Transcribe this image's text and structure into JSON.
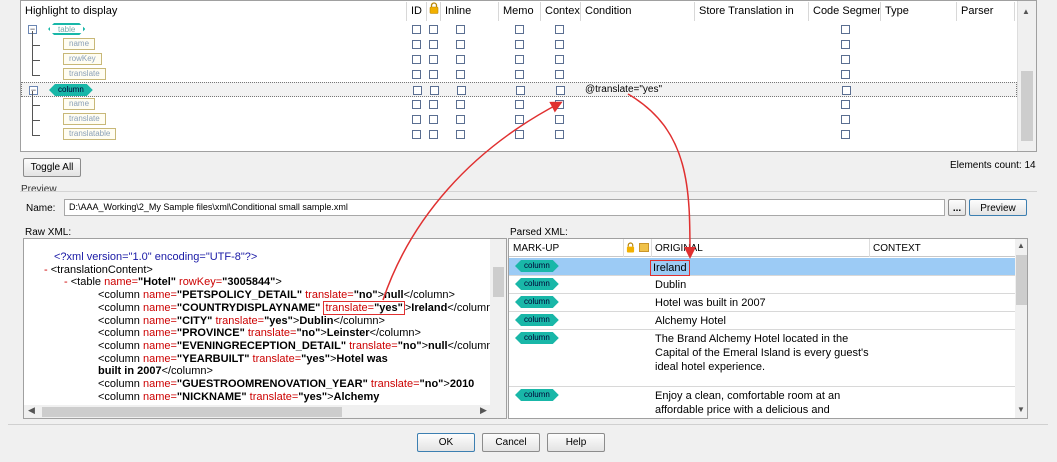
{
  "grid": {
    "columns": [
      "Highlight to display",
      "ID",
      "",
      "Inline",
      "Memo",
      "Context",
      "Condition",
      "Store Translation in",
      "Code Segment",
      "Type",
      "Parser"
    ],
    "rows": [
      {
        "tag": "table",
        "level": 0,
        "condition": ""
      },
      {
        "tag": "name",
        "level": 1,
        "condition": ""
      },
      {
        "tag": "rowKey",
        "level": 1,
        "condition": ""
      },
      {
        "tag": "translate",
        "level": 1,
        "condition": ""
      },
      {
        "tag": "column",
        "level": 0,
        "condition": "@translate=\"yes\""
      },
      {
        "tag": "name",
        "level": 1,
        "condition": ""
      },
      {
        "tag": "translate",
        "level": 1,
        "condition": ""
      },
      {
        "tag": "translatable",
        "level": 1,
        "condition": ""
      }
    ],
    "expand_symbol": "−"
  },
  "toggle_all_label": "Toggle All",
  "elements_count": "Elements count: 14",
  "preview": {
    "group_label": "Preview",
    "name_label": "Name:",
    "path": "D:\\AAA_Working\\2_My Sample files\\xml\\Conditional small sample.xml",
    "browse_label": "...",
    "preview_button": "Preview"
  },
  "raw_xml": {
    "label": "Raw XML:",
    "lines": [
      {
        "indent": 0,
        "parts": [
          {
            "t": "<?xml version=\"1.0\" encoding=\"UTF-8\"?>",
            "c": "blue"
          }
        ]
      },
      {
        "indent": 1,
        "parts": [
          {
            "t": "- ",
            "c": "red"
          },
          {
            "t": "<translationContent>"
          }
        ]
      },
      {
        "indent": 2,
        "parts": [
          {
            "t": "- ",
            "c": "red"
          },
          {
            "t": "<table "
          },
          {
            "t": "name=",
            "c": "red"
          },
          {
            "t": "\"Hotel\"",
            "c": "bold"
          },
          {
            "t": " rowKey=",
            "c": "red"
          },
          {
            "t": "\"3005844\"",
            "c": "bold"
          },
          {
            "t": ">"
          }
        ]
      },
      {
        "indent": 3,
        "parts": [
          {
            "t": "<column "
          },
          {
            "t": "name=",
            "c": "red"
          },
          {
            "t": "\"PETSPOLICY_DETAIL\"",
            "c": "bold"
          },
          {
            "t": " translate=",
            "c": "red"
          },
          {
            "t": "\"no\"",
            "c": "bold"
          },
          {
            "t": ">"
          },
          {
            "t": "null",
            "c": "bold"
          },
          {
            "t": "</column>"
          }
        ]
      },
      {
        "indent": 3,
        "parts": [
          {
            "t": "<column "
          },
          {
            "t": "name=",
            "c": "red"
          },
          {
            "t": "\"COUNTRYDISPLAYNAME\"",
            "c": "bold"
          },
          {
            "t": " "
          },
          {
            "t": "translate=",
            "c": "red",
            "box": true
          },
          {
            "t": "\"yes\"",
            "c": "bold",
            "box": true
          },
          {
            "t": ">"
          },
          {
            "t": "Ireland",
            "c": "bold"
          },
          {
            "t": "</column>"
          }
        ]
      },
      {
        "indent": 3,
        "parts": [
          {
            "t": "<column "
          },
          {
            "t": "name=",
            "c": "red"
          },
          {
            "t": "\"CITY\"",
            "c": "bold"
          },
          {
            "t": " translate=",
            "c": "red"
          },
          {
            "t": "\"yes\"",
            "c": "bold"
          },
          {
            "t": ">"
          },
          {
            "t": "Dublin",
            "c": "bold"
          },
          {
            "t": "</column>"
          }
        ]
      },
      {
        "indent": 3,
        "parts": [
          {
            "t": "<column "
          },
          {
            "t": "name=",
            "c": "red"
          },
          {
            "t": "\"PROVINCE\"",
            "c": "bold"
          },
          {
            "t": " translate=",
            "c": "red"
          },
          {
            "t": "\"no\"",
            "c": "bold"
          },
          {
            "t": ">"
          },
          {
            "t": "Leinster",
            "c": "bold"
          },
          {
            "t": "</column>"
          }
        ]
      },
      {
        "indent": 3,
        "parts": [
          {
            "t": "<column "
          },
          {
            "t": "name=",
            "c": "red"
          },
          {
            "t": "\"EVENINGRECEPTION_DETAIL\"",
            "c": "bold"
          },
          {
            "t": " translate=",
            "c": "red"
          },
          {
            "t": "\"no\"",
            "c": "bold"
          },
          {
            "t": ">"
          },
          {
            "t": "null",
            "c": "bold"
          },
          {
            "t": "</column>"
          }
        ]
      },
      {
        "indent": 3,
        "parts": [
          {
            "t": "<column "
          },
          {
            "t": "name=",
            "c": "red"
          },
          {
            "t": "\"YEARBUILT\"",
            "c": "bold"
          },
          {
            "t": " translate=",
            "c": "red"
          },
          {
            "t": "\"yes\"",
            "c": "bold"
          },
          {
            "t": ">"
          },
          {
            "t": "Hotel was",
            "c": "bold"
          }
        ]
      },
      {
        "indent": 3,
        "parts": [
          {
            "t": "built in 2007",
            "c": "bold"
          },
          {
            "t": "</column>"
          }
        ]
      },
      {
        "indent": 3,
        "parts": [
          {
            "t": "<column "
          },
          {
            "t": "name=",
            "c": "red"
          },
          {
            "t": "\"GUESTROOMRENOVATION_YEAR\"",
            "c": "bold"
          },
          {
            "t": " translate=",
            "c": "red"
          },
          {
            "t": "\"no\"",
            "c": "bold"
          },
          {
            "t": ">"
          },
          {
            "t": "2010",
            "c": "bold"
          }
        ]
      },
      {
        "indent": 3,
        "parts": [
          {
            "t": "<column "
          },
          {
            "t": "name=",
            "c": "red"
          },
          {
            "t": "\"NICKNAME\"",
            "c": "bold"
          },
          {
            "t": " translate=",
            "c": "red"
          },
          {
            "t": "\"yes\"",
            "c": "bold"
          },
          {
            "t": ">"
          },
          {
            "t": "Alchemy",
            "c": "bold"
          }
        ]
      }
    ]
  },
  "parsed_xml": {
    "label": "Parsed XML:",
    "columns": [
      "MARK-UP",
      "ORIGINAL",
      "CONTEXT"
    ],
    "rows": [
      {
        "markup": "column",
        "original": "Ireland",
        "selected": true
      },
      {
        "markup": "column",
        "original": "Dublin",
        "selected": false
      },
      {
        "markup": "column",
        "original": "Hotel was built in 2007",
        "selected": false
      },
      {
        "markup": "column",
        "original": "Alchemy Hotel",
        "selected": false
      },
      {
        "markup": "column",
        "original": "The Brand Alchemy Hotel located in the Capital of the Emeral Island is every guest's ideal hotel experience.",
        "selected": false
      },
      {
        "markup": "column",
        "original": "Enjoy a clean, comfortable room at an affordable price with a delicious and",
        "selected": false
      }
    ]
  },
  "footer": {
    "ok": "OK",
    "cancel": "Cancel",
    "help": "Help"
  },
  "colors": {
    "accent": "#19b7a8",
    "selection": "#9ccbf5",
    "annotation": "#e03030"
  }
}
